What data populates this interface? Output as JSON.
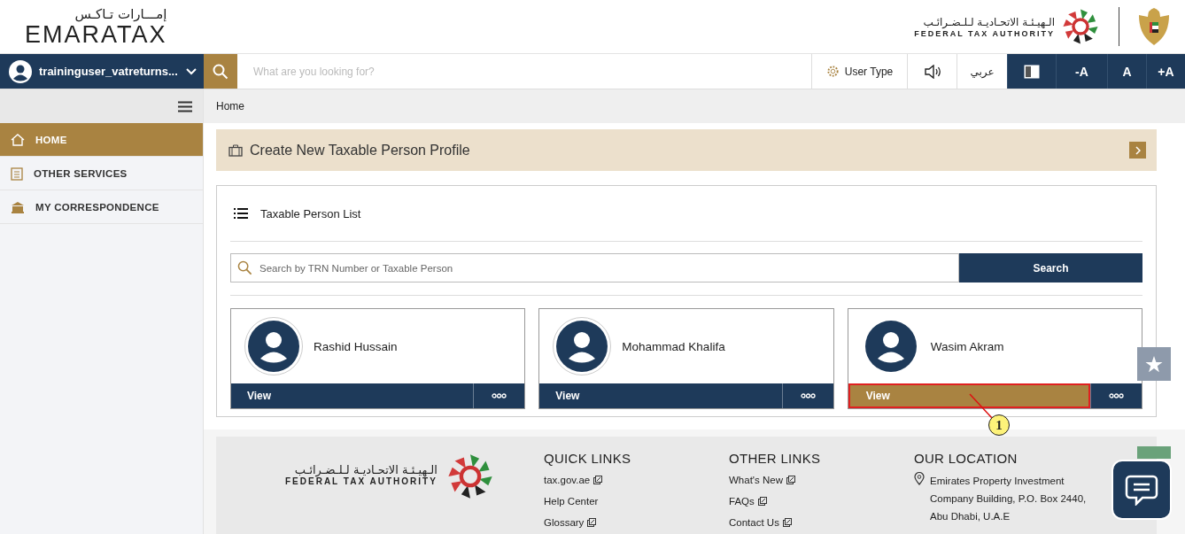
{
  "header": {
    "logo_arabic": "إمـــارات تـاكـس",
    "logo_text": "EMARATAX",
    "authority_arabic": "الـهيـئـة الاتحـاديـة لـلـضـرائـب",
    "authority_english": "FEDERAL TAX AUTHORITY"
  },
  "user_menu": {
    "username": "traininguser_vatreturns..."
  },
  "search": {
    "placeholder": "What are you looking for?"
  },
  "toolbar": [
    {
      "kind": "user_type",
      "label": "User Type"
    },
    {
      "kind": "sound"
    },
    {
      "kind": "language",
      "label": "عربي"
    },
    {
      "kind": "contrast"
    },
    {
      "kind": "text",
      "label": "-A"
    },
    {
      "kind": "text",
      "label": "A"
    },
    {
      "kind": "text",
      "label": "+A"
    }
  ],
  "breadcrumb": "Home",
  "sidebar": {
    "items": [
      {
        "label": "HOME",
        "kind": "home",
        "selected": true
      },
      {
        "label": "OTHER SERVICES",
        "kind": "services",
        "selected": false
      },
      {
        "label": "MY CORRESPONDENCE",
        "kind": "correspondence",
        "selected": false
      }
    ]
  },
  "create_banner": {
    "title": "Create New Taxable Person Profile"
  },
  "taxable_person_list": {
    "title": "Taxable Person List",
    "search": {
      "placeholder": "Search by TRN Number or Taxable Person"
    },
    "search_button": "Search",
    "persons": [
      {
        "name": "Rashid Hussain",
        "view_label": "View",
        "highlighted": false
      },
      {
        "name": "Mohammad Khalifa",
        "view_label": "View",
        "highlighted": false
      },
      {
        "name": "Wasim Akram",
        "view_label": "View",
        "highlighted": true
      }
    ]
  },
  "callout": {
    "number": "1"
  },
  "footer": {
    "authority_arabic": "الـهيـئـة الاتحـاديـة لـلـضـرائـب",
    "authority_english": "FEDERAL TAX AUTHORITY",
    "columns": [
      {
        "title": "QUICK LINKS",
        "links": [
          {
            "label": "tax.gov.ae",
            "external": true
          },
          {
            "label": "Help Center",
            "external": false
          },
          {
            "label": "Glossary",
            "external": true
          }
        ]
      },
      {
        "title": "OTHER LINKS",
        "links": [
          {
            "label": "What's New",
            "external": true
          },
          {
            "label": "FAQs",
            "external": true
          },
          {
            "label": "Contact Us",
            "external": true
          }
        ]
      }
    ],
    "location": {
      "title": "OUR LOCATION",
      "address": "Emirates Property Investment Company Building, P.O. Box 2440, Abu Dhabi, U.A.E"
    }
  }
}
